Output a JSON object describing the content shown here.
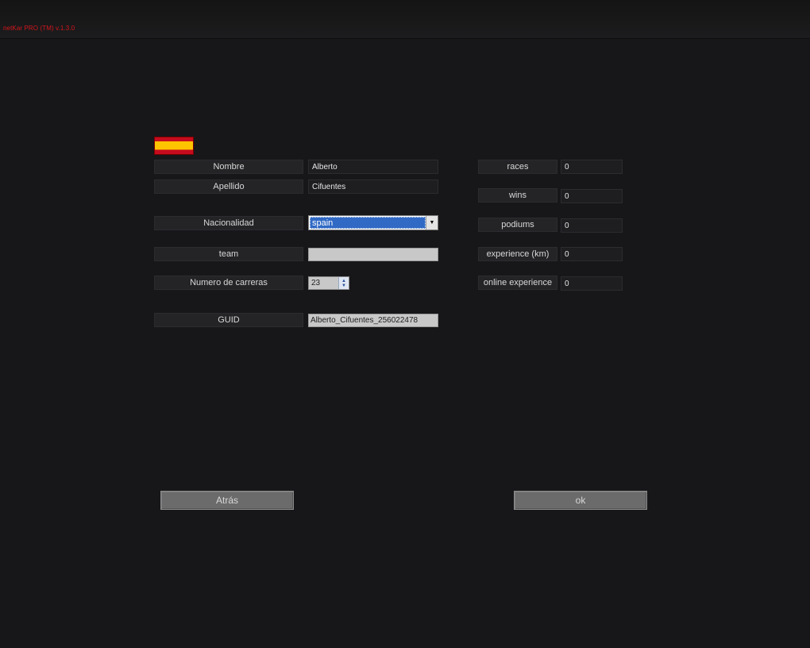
{
  "app": {
    "title": "netKar PRO (TM) v.1.3.0"
  },
  "profile": {
    "nombre": {
      "label": "Nombre",
      "value": "Alberto"
    },
    "apellido": {
      "label": "Apellido",
      "value": "Cifuentes"
    },
    "nacionalidad": {
      "label": "Nacionalidad",
      "selected": "spain"
    },
    "team": {
      "label": "team",
      "value": ""
    },
    "carreras": {
      "label": "Numero de carreras",
      "value": "23"
    },
    "guid": {
      "label": "GUID",
      "value": "Alberto_Cifuentes_256022478"
    }
  },
  "stats": [
    {
      "label": "races",
      "value": "0"
    },
    {
      "label": "wins",
      "value": "0"
    },
    {
      "label": "podiums",
      "value": "0"
    },
    {
      "label": "experience (km)",
      "value": "0"
    },
    {
      "label": "online experience",
      "value": "0"
    }
  ],
  "buttons": {
    "back": "Atrás",
    "ok": "ok"
  },
  "flag_colors": {
    "red": "#c60b1e",
    "yellow": "#ffc400"
  }
}
